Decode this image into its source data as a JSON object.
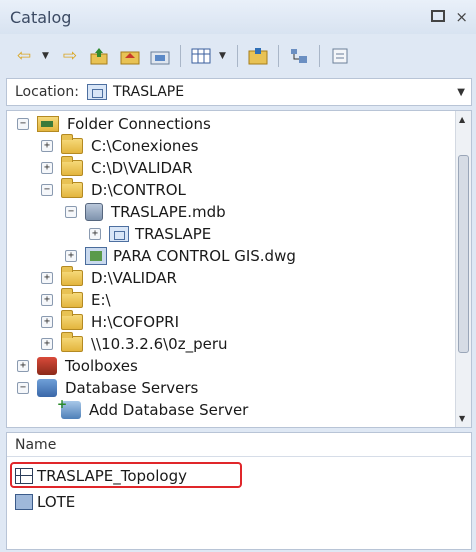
{
  "window": {
    "title": "Catalog",
    "pin_icon": "pin-icon",
    "close_glyph": "×"
  },
  "toolbar": {
    "icons": [
      "back-arrow-icon",
      "forward-arrow-icon",
      "up-level-icon",
      "home-folder-icon",
      "connect-folder-icon",
      "views-grid-icon",
      "new-item-icon",
      "toggle-contents-icon",
      "properties-icon"
    ],
    "back_glyph": "⇦",
    "forward_glyph": "⇨"
  },
  "location": {
    "label": "Location:",
    "value": "TRASLAPE"
  },
  "tree": {
    "items": [
      {
        "label": "Folder Connections",
        "expander": "−",
        "icon": "folder-connections-icon"
      },
      {
        "label": "C:\\Conexiones",
        "expander": "+",
        "icon": "folder-icon"
      },
      {
        "label": "C:\\D\\VALIDAR",
        "expander": "+",
        "icon": "folder-icon"
      },
      {
        "label": "D:\\CONTROL",
        "expander": "−",
        "icon": "folder-icon"
      },
      {
        "label": "TRASLAPE.mdb",
        "expander": "−",
        "icon": "geodatabase-icon"
      },
      {
        "label": "TRASLAPE",
        "expander": "+",
        "icon": "feature-dataset-icon"
      },
      {
        "label": "PARA CONTROL GIS.dwg",
        "expander": "+",
        "icon": "cad-drawing-icon"
      },
      {
        "label": "D:\\VALIDAR",
        "expander": "+",
        "icon": "folder-icon"
      },
      {
        "label": "E:\\",
        "expander": "+",
        "icon": "folder-icon"
      },
      {
        "label": "H:\\COFOPRI",
        "expander": "+",
        "icon": "folder-icon"
      },
      {
        "label": "\\\\10.3.2.6\\0z_peru",
        "expander": "+",
        "icon": "folder-icon"
      },
      {
        "label": "Toolboxes",
        "expander": "+",
        "icon": "toolbox-icon"
      },
      {
        "label": "Database Servers",
        "expander": "−",
        "icon": "database-servers-icon"
      },
      {
        "label": "Add Database Server",
        "expander": "",
        "icon": "add-database-server-icon"
      }
    ]
  },
  "contents": {
    "column_name": "Name",
    "rows": [
      {
        "label": "TRASLAPE_Topology",
        "icon": "topology-icon",
        "highlighted": true
      },
      {
        "label": "LOTE",
        "icon": "polygon-feature-class-icon",
        "highlighted": false
      }
    ]
  },
  "colors": {
    "highlight_border": "#e0262a",
    "panel_background": "#dfe8f4"
  }
}
